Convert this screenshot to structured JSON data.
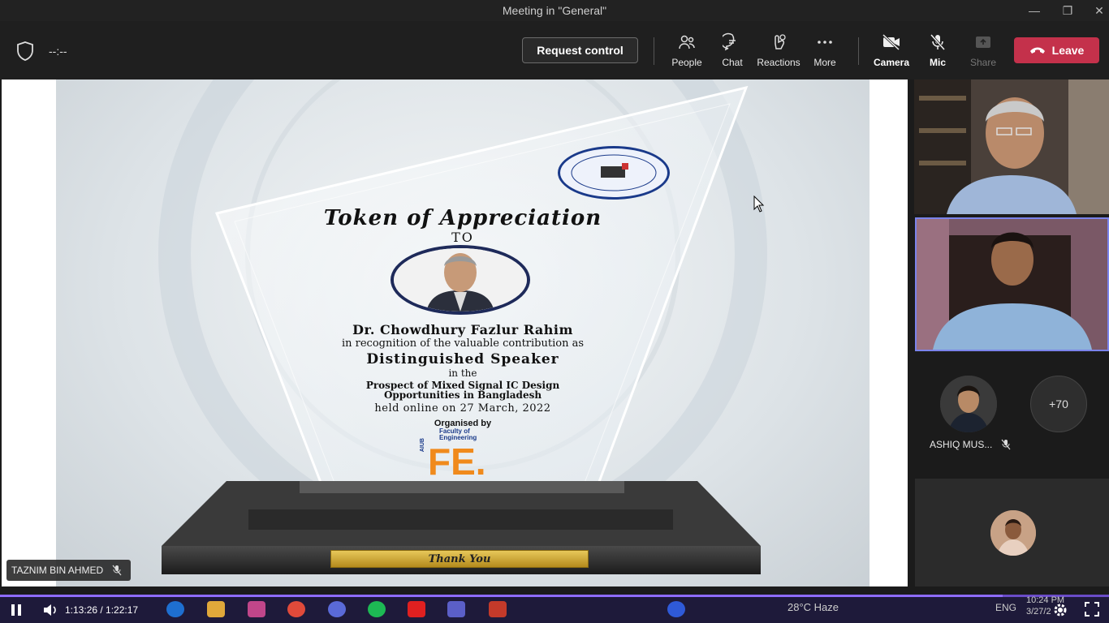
{
  "window": {
    "title": "Meeting in \"General\"",
    "minimize": "—",
    "restore": "❐",
    "close": "✕"
  },
  "toolbar": {
    "timer": "--:--",
    "request_control": "Request control",
    "people": "People",
    "chat": "Chat",
    "reactions": "Reactions",
    "more": "More",
    "camera": "Camera",
    "mic": "Mic",
    "share": "Share",
    "leave": "Leave"
  },
  "slide": {
    "title": "Token of Appreciation",
    "to": "TO",
    "name": "Dr. Chowdhury Fazlur Rahim",
    "recognition": "in recognition of the valuable contribution as",
    "role": "Distinguished Speaker",
    "in_the": "in the",
    "topic_line1": "Prospect of Mixed Signal IC Design",
    "topic_line2": "Opportunities in Bangladesh",
    "held": "held online on 27 March, 2022",
    "organised_by": "Organised by",
    "plaque": "Thank You",
    "logo_text": "FE.",
    "logo_sub": "Faculty of Engineering",
    "logo_side": "AIUB"
  },
  "presenter_badge": "TAZNIM BIN AHMED",
  "participants": {
    "overflow_count": "+70",
    "tile_name": "ASHIQ MUS..."
  },
  "player": {
    "time": "1:13:26 / 1:22:17",
    "progress_fraction": 0.904
  },
  "taskbar": {
    "weather": "28°C  Haze",
    "language": "ENG",
    "clock_time": "10:24 PM",
    "clock_date": "3/27/2"
  },
  "colors": {
    "leave": "#c4314b",
    "accent": "#7b83eb",
    "progress": "#8e6cff"
  }
}
